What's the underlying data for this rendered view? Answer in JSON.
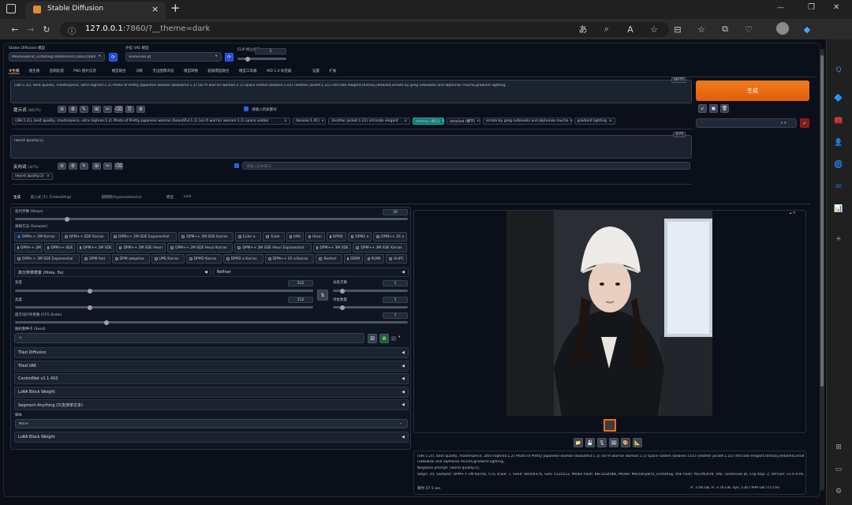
{
  "browser": {
    "tab_title": "Stable Diffusion",
    "url_main": "127.0.0.1",
    "url_rest": ":7860/?__theme=dark",
    "tab_close": "×",
    "new_tab": "+",
    "win_min": "—",
    "win_max": "❐",
    "win_close": "✕",
    "back_icon": "←",
    "forward_icon": "→",
    "reload_icon": "↻",
    "info_icon": "ⓘ",
    "toolbar_icons": [
      "あ",
      "⌕",
      "A",
      "☆",
      "⊟",
      "☆",
      "⧉",
      "♡",
      "●",
      "◆"
    ]
  },
  "settings": {
    "checkpoint_label": "Stable Diffusion 模型",
    "checkpoint_value": "MeinaHyBrid_v10Stdvg.safetensors [b6a1ca4db6]",
    "vae_label": "外挂 VAE 模型",
    "vae_value": "animevae.pt",
    "clip_label": "CLIP 终止层数",
    "clip_value": "2",
    "refresh_icon": "⟳",
    "dropdown_icon": "▾"
  },
  "tabs": [
    "文生图",
    "图生图",
    "后期处理",
    "PNG 图片信息",
    "模型融合",
    "训练",
    "无边图像浏览",
    "模型转换",
    "超级模型融合",
    "模型工具箱",
    "WD 1.4 标签器",
    "设置",
    "扩展"
  ],
  "prompt": {
    "text": "((8k:1.2)), best quality, masterpiece, ultra highres:1.2) Photo of Pretty Japanese woman (beautiful:1.1) (sci-fi warrior woman:1.1) space soldier,(beanie:1.61) (leather jacket:1.21) intricate elegant,fantasy,detailed,ornate by greg rutkowski and alphonse mucha,gradient lighting,",
    "count": "46/75",
    "title": "提示词",
    "title_count": "(46/75)",
    "tool_icons": [
      "⊘",
      "⚙",
      "✎",
      "⊞",
      "✂",
      "⌫",
      "⎘",
      "⚙"
    ],
    "translate_label": "请输入新关键词",
    "tags": [
      "((8k:1.2)), best quality, masterpiece, ultra highres:1.2) Photo of Pretty Japanese woman (beautiful:1.1) (sci-fi warrior woman:1.1) space soldier",
      "(beanie:1.61)",
      "(leather jacket:1.21) intricate elegant",
      "fantasy (奇幻)",
      "detailed (细节)",
      "ornate by greg rutkowski and alphonse mucha",
      "gradient lighting"
    ]
  },
  "neg_prompt": {
    "text": "(worst quality:2),",
    "count": "3/75",
    "title": "反向词",
    "title_count": "(3/75)",
    "tool_icons": [
      "⊘",
      "⚙",
      "✎",
      "⊞",
      "✂",
      "⌫"
    ],
    "translate_label": "请输入新关键词",
    "tags": [
      "(worst quality:2)"
    ]
  },
  "generate": {
    "label": "生成",
    "style_icons": [
      "↙",
      "▣",
      "🗑"
    ],
    "style_apply_icon": "✓"
  },
  "sub_tabs": [
    "生成",
    "嵌入式 (T.I. Embedding)",
    "超网络(Hypernetworks)",
    "模型",
    "Lora"
  ],
  "params": {
    "steps_label": "迭代步数 (Steps)",
    "steps_value": 20,
    "steps_max": 150,
    "sampler_label": "采样方法 (Sampler)",
    "samplers": [
      [
        "DPM++ 2M Karras",
        "DPM++ SDE Karras",
        "DPM++ 2M SDE Exponential",
        "DPM++ 2M SDE Karras",
        "Euler a",
        "Euler",
        "LMS",
        "Heun",
        "DPM2",
        "DPM2 a",
        "DPM++ 2S a"
      ],
      [
        "DPM++ 2M",
        "DPM++ SDE",
        "DPM++ 2M SDE",
        "DPM++ 2M SDE Heun",
        "DPM++ 2M SDE Heun Karras",
        "DPM++ 2M SDE Heun Exponential",
        "DPM++ 3M SDE",
        "DPM++ 3M SDE Karras"
      ],
      [
        "DPM++ 3M SDE Exponential",
        "DPM fast",
        "DPM adaptive",
        "LMS Karras",
        "DPM2 Karras",
        "DPM2 a Karras",
        "DPM++ 2S a Karras",
        "Restart",
        "DDIM",
        "PLMS",
        "UniPC"
      ]
    ],
    "hires_label": "高分辨率修复 (Hires. fix)",
    "refiner_label": "Refiner",
    "width_label": "宽度",
    "width_value": 512,
    "height_label": "高度",
    "height_value": 512,
    "size_max": 2048,
    "swap_icon": "⇅",
    "batch_count_label": "总批次数",
    "batch_count_value": 1,
    "batch_size_label": "单批数量",
    "batch_size_value": 1,
    "batch_max": 8,
    "cfg_label": "提示词引导系数 (CFG Scale)",
    "cfg_value": 7,
    "cfg_max": 30,
    "seed_label": "随机数种子 (Seed)",
    "seed_value": "-1",
    "seed_icons": [
      "⚄",
      "♻"
    ],
    "accordions": [
      "Tiled Diffusion",
      "Tiled VAE",
      "ControlNet v1.1.410",
      "LoRA Block Weight",
      "Segment Anything (只支持单次多)"
    ],
    "script_label": "脚本",
    "script_value": "None",
    "last_accordion": "LoRA Block Weight",
    "arrow": "◀"
  },
  "output": {
    "image_caption": "Japanese woman with white beanie and black leather jacket by a window",
    "corner_icons": "▴ ✕",
    "action_icons": [
      "📁",
      "💾",
      "🗜",
      "🖼",
      "🎨",
      "📐"
    ],
    "info_line1": "((8k:1.2)), best quality, masterpiece, ultra highres:1.2) Photo of Pretty Japanese woman (beautiful:1.1) (sci-fi warrior woman:1.1) space soldier,(beanie:1.61) (leather jacket:1.21) intricate elegant,fantasy,detailed,ornate by greg",
    "info_line2": "rutkowski and alphonse mucha,gradient lighting,",
    "info_line3": "Negative prompt: (worst quality:2),",
    "info_line4": "Steps: 20, Sampler: DPM++ 2M Karras, CFG scale: 7, Seed: 66564376, Size: 512x512, Model hash: b6c1ca4db6, Model: MeinaHyBrid_v10Stdvg, VAE hash: f921fb3f29, VAE: animevae.pt, Clip skip: 2, Version: v1.6.0-RC-349-g2b4d9ed",
    "time_label": "耗时 47.5 sec.",
    "vram_label": "A: 3.44 GB, R: 3.76 GB, Sys: 5.8/7.999 GB (73.1%)"
  },
  "edge_sidebar": {
    "icons": [
      "Q",
      "🔷",
      "🧰",
      "👤",
      "🌀",
      "✉",
      "📊",
      "+",
      "⊞",
      "▭",
      "⚙"
    ],
    "colors": [
      "#3b82f6",
      "#4f7fd9",
      "#c0504d",
      "#2d7dd2",
      "#7b5cd6",
      "#0a74da",
      "#43a047",
      "#9ca3af",
      "#9ca3af",
      "#9ca3af",
      "#9ca3af"
    ]
  },
  "colors": {
    "accent": "#ea6b12",
    "selected_chip": "#0f766e"
  }
}
